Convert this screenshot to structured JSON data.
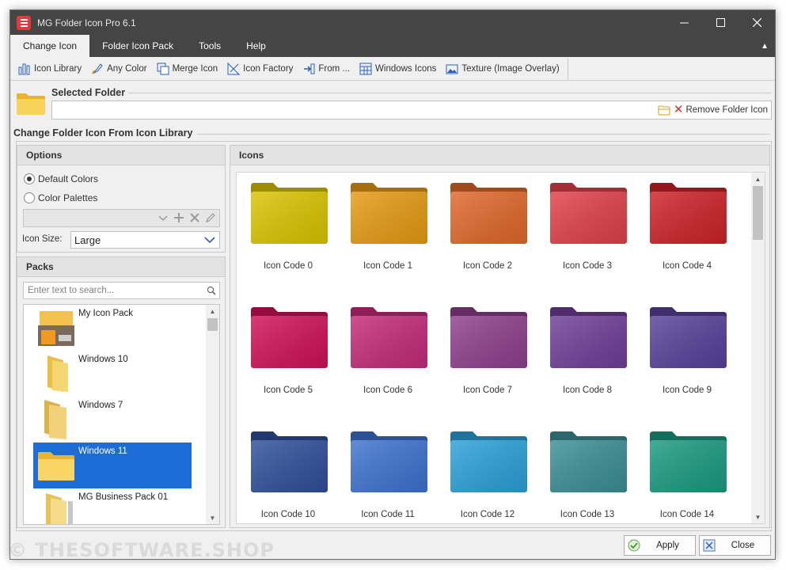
{
  "window": {
    "title": "MG Folder Icon Pro 6.1",
    "controls": {
      "minimize": "—",
      "maximize": "☐",
      "close": "✕"
    }
  },
  "menubar": {
    "items": [
      "Change Icon",
      "Folder Icon Pack",
      "Tools",
      "Help"
    ],
    "active_index": 0,
    "collapse_glyph": "▲"
  },
  "toolbar": {
    "items": [
      {
        "label": "Icon Library",
        "icon": "bar-chart-icon"
      },
      {
        "label": "Any Color",
        "icon": "paint-brush-icon"
      },
      {
        "label": "Merge Icon",
        "icon": "merge-icon"
      },
      {
        "label": "Icon Factory",
        "icon": "pen-ruler-icon"
      },
      {
        "label": "From ...",
        "icon": "import-arrow-icon"
      },
      {
        "label": "Windows Icons",
        "icon": "grid-window-icon"
      },
      {
        "label": "Texture (Image Overlay)",
        "icon": "image-icon"
      }
    ]
  },
  "selected_folder": {
    "label": "Selected Folder",
    "value": "",
    "remove_label": "Remove Folder Icon"
  },
  "section_title": "Change Folder Icon From Icon Library",
  "options": {
    "header": "Options",
    "radio_default": "Default Colors",
    "radio_palettes": "Color Palettes",
    "selected": "Default Colors",
    "icon_size_label": "Icon Size:",
    "icon_size_value": "Large"
  },
  "packs": {
    "header": "Packs",
    "search_placeholder": "Enter text to search...",
    "items": [
      {
        "name": "My Icon Pack",
        "selected": false
      },
      {
        "name": "Windows 10",
        "selected": false
      },
      {
        "name": "Windows 7",
        "selected": false
      },
      {
        "name": "Windows 11",
        "selected": true
      },
      {
        "name": "MG Business Pack 01",
        "selected": false
      }
    ]
  },
  "icons": {
    "header": "Icons",
    "items": [
      {
        "label": "Icon Code 0",
        "color": "#d9c400"
      },
      {
        "label": "Icon Code 1",
        "color": "#e59a12"
      },
      {
        "label": "Icon Code 2",
        "color": "#e0672a"
      },
      {
        "label": "Icon Code 3",
        "color": "#e04048"
      },
      {
        "label": "Icon Code 4",
        "color": "#cc2228"
      },
      {
        "label": "Icon Code 5",
        "color": "#d01058"
      },
      {
        "label": "Icon Code 6",
        "color": "#c42a7a"
      },
      {
        "label": "Icon Code 7",
        "color": "#8e3f8c"
      },
      {
        "label": "Icon Code 8",
        "color": "#6e3e98"
      },
      {
        "label": "Icon Code 9",
        "color": "#57419a"
      },
      {
        "label": "Icon Code 10",
        "color": "#2f4f9a"
      },
      {
        "label": "Icon Code 11",
        "color": "#3d72cf"
      },
      {
        "label": "Icon Code 12",
        "color": "#2ba0d8"
      },
      {
        "label": "Icon Code 13",
        "color": "#3a8e94"
      },
      {
        "label": "Icon Code 14",
        "color": "#1a9a80"
      }
    ]
  },
  "buttons": {
    "apply": "Apply",
    "close": "Close"
  },
  "watermark": "© THESOFTWARE.SHOP"
}
